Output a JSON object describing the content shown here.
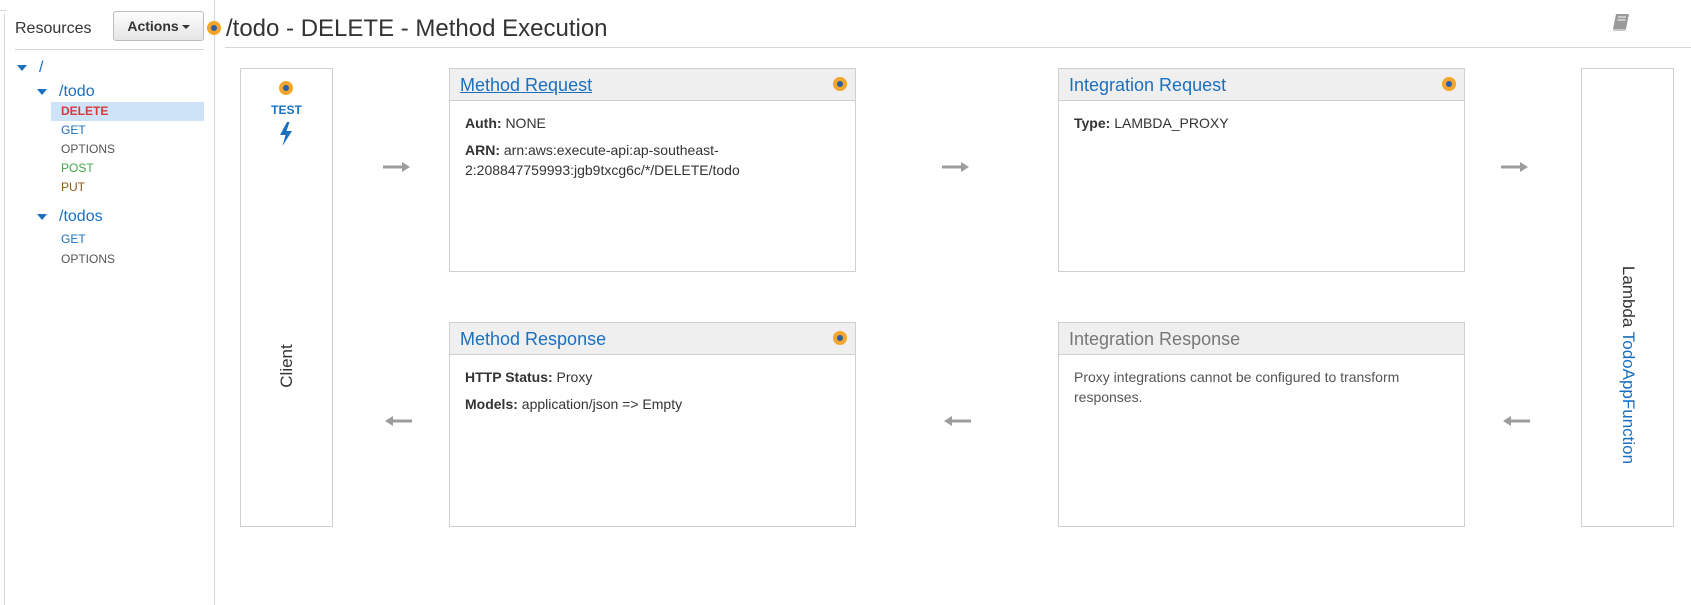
{
  "sidebar": {
    "title": "Resources",
    "actions_label": "Actions",
    "tree": {
      "root": "/",
      "todo": {
        "path": "/todo",
        "methods": [
          "DELETE",
          "GET",
          "OPTIONS",
          "POST",
          "PUT"
        ]
      },
      "todos": {
        "path": "/todos",
        "methods": [
          "GET",
          "OPTIONS"
        ]
      }
    },
    "selected_method": "DELETE"
  },
  "header": {
    "title": "/todo - DELETE - Method Execution"
  },
  "client": {
    "test_label": "TEST",
    "label": "Client"
  },
  "method_request": {
    "title": "Method Request",
    "auth_key": "Auth:",
    "auth_value": "NONE",
    "arn_key": "ARN:",
    "arn_value_line1": "arn:aws:execute-api:ap-southeast-",
    "arn_value_line2": "2:208847759993:jgb9txcg6c/*/DELETE/todo"
  },
  "integration_request": {
    "title": "Integration Request",
    "type_key": "Type:",
    "type_value": "LAMBDA_PROXY"
  },
  "method_response": {
    "title": "Method Response",
    "status_key": "HTTP Status:",
    "status_value": "Proxy",
    "models_key": "Models:",
    "models_value": "application/json => Empty"
  },
  "integration_response": {
    "title": "Integration Response",
    "note_line1": "Proxy integrations cannot be configured to transform",
    "note_line2": "responses."
  },
  "lambda": {
    "prefix": "Lambda",
    "function_name": "TodoAppFunction"
  },
  "colors": {
    "link_blue": "#1a6fc0",
    "delete_red": "#d9393a",
    "post_green": "#3fa64a",
    "put_brown": "#8a5a1e",
    "dot_orange": "#f4a52c",
    "selected_bg": "#cfe3f8"
  },
  "icons": {
    "header": "book-icon",
    "test": "lightning-bolt-icon",
    "panel": "orange-dot-icon"
  }
}
